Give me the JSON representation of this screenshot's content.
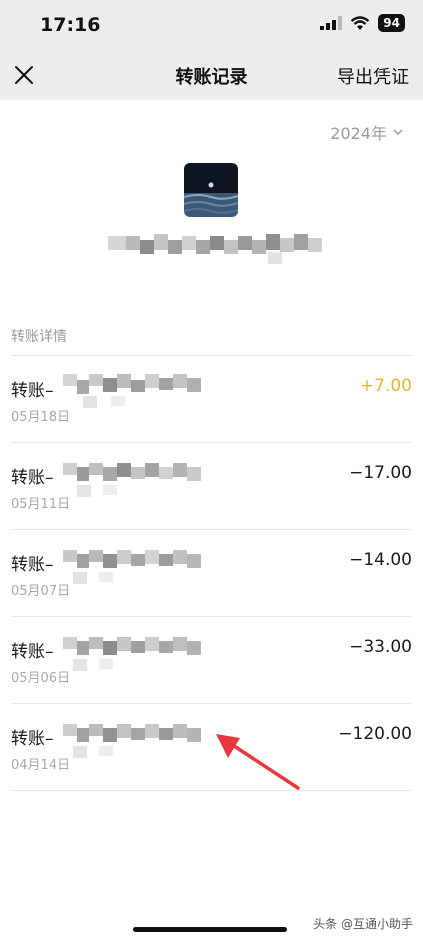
{
  "status_bar": {
    "time": "17:16",
    "battery": "94"
  },
  "nav": {
    "title": "转账记录",
    "export_label": "导出凭证"
  },
  "year_picker": {
    "label": "2024年"
  },
  "section_label": "转账详情",
  "transactions": [
    {
      "title": "转账–",
      "date": "05月18日",
      "amount": "+7.00",
      "type": "income"
    },
    {
      "title": "转账–",
      "date": "05月11日",
      "amount": "−17.00",
      "type": "expense"
    },
    {
      "title": "转账–",
      "date": "05月07日",
      "amount": "−14.00",
      "type": "expense"
    },
    {
      "title": "转账–",
      "date": "05月06日",
      "amount": "−33.00",
      "type": "expense"
    },
    {
      "title": "转账–",
      "date": "04月14日",
      "amount": "−120.00",
      "type": "expense"
    }
  ],
  "watermark": "头条 @互通小助手",
  "colors": {
    "income": "#e8b62e",
    "header_bg": "#ededed",
    "arrow": "#e8383d"
  }
}
